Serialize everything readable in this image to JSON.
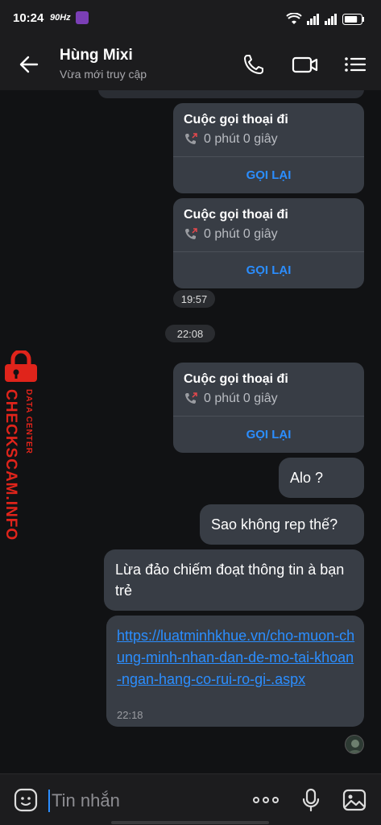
{
  "status_bar": {
    "time": "10:24",
    "refresh": "90Hz",
    "battery_level": 0.8
  },
  "header": {
    "title": "Hùng Mixi",
    "subtitle": "Vừa mới truy cập"
  },
  "messages": {
    "call_cards": [
      {
        "title": "Cuộc gọi thoại đi",
        "duration": "0 phút 0 giây",
        "action": "GỌI LẠI"
      },
      {
        "title": "Cuộc gọi thoại đi",
        "duration": "0 phút 0 giây",
        "action": "GỌI LẠI"
      },
      {
        "title": "Cuộc gọi thoại đi",
        "duration": "0 phút 0 giây",
        "action": "GỌI LẠI"
      }
    ],
    "time_1957": "19:57",
    "time_2208": "22:08",
    "bubble_alo": "Alo ?",
    "bubble_rep": "Sao không rep thế?",
    "bubble_lua": "Lừa đảo chiếm đoạt thông tin à bạn trẻ",
    "link_url": "https://luatminhkhue.vn/cho-muon-chung-minh-nhan-dan-de-mo-tai-khoan-ngan-hang-co-rui-ro-gi-.aspx",
    "link_time": "22:18"
  },
  "watermark": {
    "line1": "DATA CENTER",
    "line2": "CHECKSCAM.INFO"
  },
  "input": {
    "placeholder": "Tin nhắn"
  },
  "colors": {
    "accent": "#2b8eff",
    "bubble": "#383d45",
    "background": "#111214",
    "watermark": "#e0241b"
  }
}
